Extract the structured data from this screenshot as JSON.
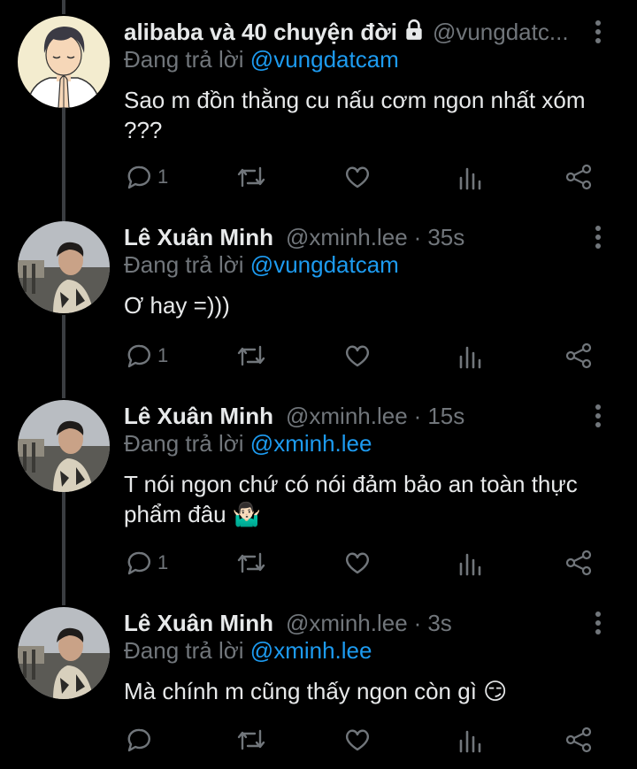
{
  "reply_prefix": "Đang trả lời",
  "tweets": [
    {
      "name": "alibaba và 40 chuyện đời",
      "handle": "@vungdatc...",
      "time": "",
      "reply_to": "@vungdatcam",
      "text": "Sao m đồn thằng cu nấu cơm ngon nhất xóm ???",
      "reply_count": "1",
      "avatar": "anime-boy-praying"
    },
    {
      "name": "Lê Xuân Minh",
      "handle": "@xminh.lee",
      "time": "35s",
      "reply_to": "@vungdatcam",
      "text": "Ơ hay =)))",
      "reply_count": "1",
      "avatar": "man-photo"
    },
    {
      "name": "Lê Xuân Minh",
      "handle": "@xminh.lee",
      "time": "15s",
      "reply_to": "@xminh.lee",
      "text": "T nói ngon chứ có nói đảm bảo an toàn thực phẩm đâu 🤷🏻‍♂️",
      "reply_count": "1",
      "avatar": "man-photo"
    },
    {
      "name": "Lê Xuân Minh",
      "handle": "@xminh.lee",
      "time": "3s",
      "reply_to": "@xminh.lee",
      "text": "Mà chính m cũng thấy ngon còn gì 😏",
      "reply_count": "",
      "avatar": "man-photo"
    }
  ],
  "colors": {
    "background": "#000000",
    "text": "#e7e9ea",
    "secondary": "#71767b",
    "link": "#1d9bf0",
    "thread_line": "#3a3d41"
  }
}
